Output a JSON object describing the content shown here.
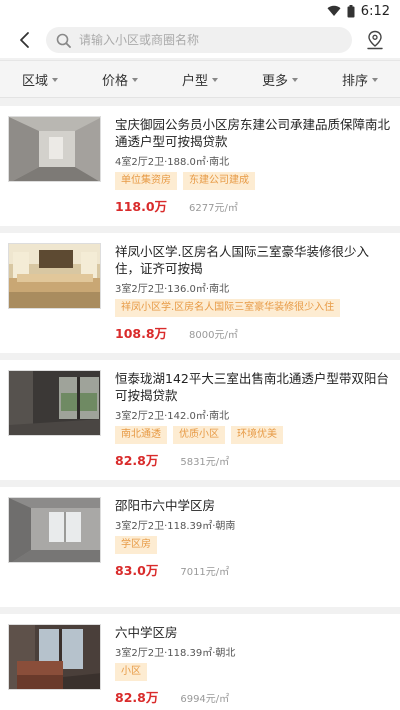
{
  "status": {
    "time": "6:12"
  },
  "search": {
    "placeholder": "请输入小区或商圈名称"
  },
  "filters": [
    {
      "label": "区域"
    },
    {
      "label": "价格"
    },
    {
      "label": "户型"
    },
    {
      "label": "更多"
    },
    {
      "label": "排序"
    }
  ],
  "listings": [
    {
      "title": "宝庆御园公务员小区房东建公司承建品质保障南北通透户型可按揭贷款",
      "spec": "4室2厅2卫·188.0㎡·南北",
      "tags": [
        "单位集资房",
        "东建公司建成"
      ],
      "price": "118.0万",
      "unit_price": "6277元/㎡"
    },
    {
      "title": "祥凤小区学.区房名人国际三室豪华装修很少入住，证齐可按揭",
      "spec": "3室2厅2卫·136.0㎡·南北",
      "tags": [
        "祥凤小区学.区房名人国际三室豪华装修很少入住"
      ],
      "price": "108.8万",
      "unit_price": "8000元/㎡"
    },
    {
      "title": "恒泰珑湖142平大三室出售南北通透户型带双阳台可按揭贷款",
      "spec": "3室2厅2卫·142.0㎡·南北",
      "tags": [
        "南北通透",
        "优质小区",
        "环境优美"
      ],
      "price": "82.8万",
      "unit_price": "5831元/㎡"
    },
    {
      "title": "邵阳市六中学区房",
      "spec": "3室2厅2卫·118.39㎡·朝南",
      "tags": [
        "学区房"
      ],
      "price": "83.0万",
      "unit_price": "7011元/㎡"
    },
    {
      "title": "六中学区房",
      "spec": "3室2厅2卫·118.39㎡·朝北",
      "tags": [
        "小区"
      ],
      "price": "82.8万",
      "unit_price": "6994元/㎡"
    }
  ]
}
